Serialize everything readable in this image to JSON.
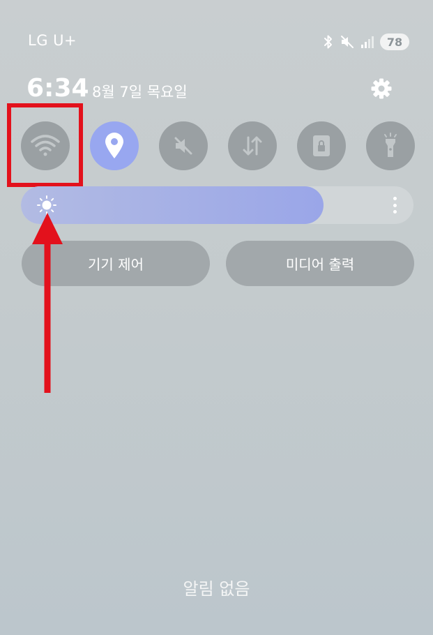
{
  "status_bar": {
    "carrier": "LG U+",
    "battery": "78",
    "icons": [
      "bluetooth-icon",
      "mute-icon",
      "signal-icon"
    ]
  },
  "header": {
    "time": "6:34",
    "date": "8월 7일 목요일",
    "settings_icon": "gear-icon"
  },
  "quick_tiles": [
    {
      "name": "wifi",
      "icon": "wifi-icon",
      "active": false
    },
    {
      "name": "location",
      "icon": "location-pin-icon",
      "active": true
    },
    {
      "name": "sound",
      "icon": "mute-icon",
      "active": false
    },
    {
      "name": "mobile-data",
      "icon": "data-transfer-icon",
      "active": false
    },
    {
      "name": "screen-lock",
      "icon": "lock-icon",
      "active": false
    },
    {
      "name": "flashlight",
      "icon": "flashlight-icon",
      "active": false
    }
  ],
  "brightness": {
    "level_percent": 77,
    "icon": "sun-icon",
    "more_icon": "more-vertical-icon"
  },
  "buttons": {
    "device_control": "기기 제어",
    "media_output": "미디어 출력"
  },
  "notifications": {
    "empty_text": "알림 없음"
  },
  "colors": {
    "accent": "#98a7f0",
    "tile_inactive": "#9aa0a3",
    "annotation": "#e3111c"
  }
}
